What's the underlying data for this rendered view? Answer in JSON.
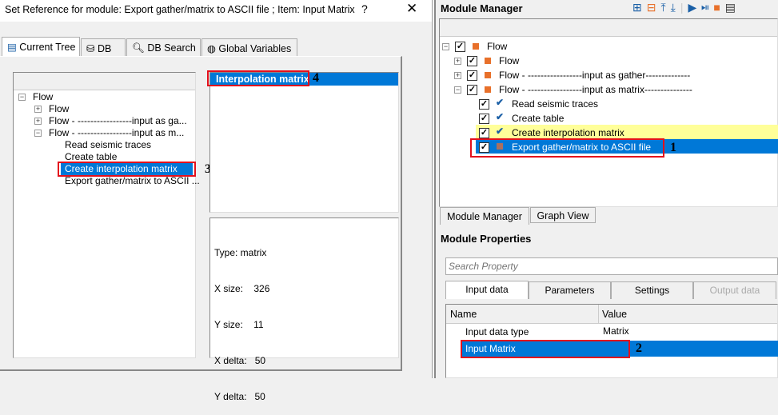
{
  "dialog": {
    "title": "Set Reference for module: Export gather/matrix to ASCII file ; Item: Input Matrix",
    "help_label": "?",
    "close_label": "✕",
    "tabs": [
      {
        "label": "Current Tree",
        "icon": "tree-icon"
      },
      {
        "label": "DB",
        "icon": "database-icon"
      },
      {
        "label": "DB Search",
        "icon": "search-icon"
      },
      {
        "label": "Global Variables",
        "icon": "globe-icon"
      }
    ],
    "tree": {
      "root": "Flow",
      "children": [
        "Flow",
        "Flow - -----------------input as ga...",
        "Flow - -----------------input as m..."
      ],
      "grandchildren": [
        "Read seismic traces",
        "Create table",
        "Create interpolation matrix",
        "Export gather/matrix to ASCII ..."
      ],
      "selected": "Create interpolation matrix"
    },
    "items": [
      "Interpolation matrix"
    ],
    "info": [
      "Type: matrix",
      "X size:    326",
      "Y size:    11",
      "X delta:   50",
      "Y delta:   50"
    ]
  },
  "annotations": [
    "1",
    "2",
    "3",
    "4"
  ],
  "module_manager": {
    "title": "Module Manager",
    "toolbar": [
      "add-module-icon",
      "remove-module-icon",
      "move-up-icon",
      "move-down-icon",
      "run-icon",
      "run-step-icon",
      "stop-icon",
      "list-icon"
    ],
    "tree": {
      "root": "Flow",
      "children": [
        "Flow",
        "Flow - -----------------input as gather--------------",
        "Flow - -----------------input as matrix---------------"
      ],
      "grandchildren": [
        "Read seismic traces",
        "Create table",
        "Create interpolation matrix",
        "Export gather/matrix to ASCII file"
      ],
      "highlighted": "Create interpolation matrix",
      "selected": "Export gather/matrix to ASCII file"
    },
    "bottom_tabs": [
      "Module Manager",
      "Graph View"
    ]
  },
  "module_properties": {
    "title": "Module Properties",
    "search_placeholder": "Search Property",
    "tabs": [
      "Input data",
      "Parameters",
      "Settings",
      "Output data"
    ],
    "columns": [
      "Name",
      "Value"
    ],
    "rows": [
      {
        "name": "Input data type",
        "value": "Matrix"
      },
      {
        "name": "Input Matrix",
        "value": ""
      }
    ]
  },
  "colors": {
    "selection": "#0078d7",
    "highlight": "#ffff99",
    "annotation_box": "#e3101c",
    "module_square": "#e8702a"
  }
}
